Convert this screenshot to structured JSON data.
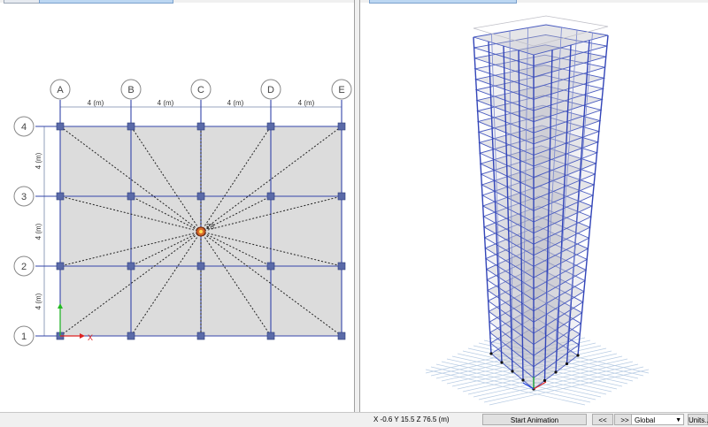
{
  "plan_view": {
    "grid_x_labels": [
      "A",
      "B",
      "C",
      "D",
      "E"
    ],
    "grid_y_labels": [
      "4",
      "3",
      "2",
      "1"
    ],
    "x_spacing_labels": [
      "4 (m)",
      "4 (m)",
      "4 (m)",
      "4 (m)"
    ],
    "y_spacing_labels": [
      "4 (m)",
      "4 (m)",
      "4 (m)"
    ],
    "axis_x_label": "X",
    "point_label": "23"
  },
  "status_bar": {
    "coordinates": "X -0.6  Y 15.5  Z 76.5 (m)",
    "start_animation_label": "Start Animation",
    "step_back_label": "<<",
    "step_forward_label": ">>",
    "coord_system": "Global",
    "units_label": "Units..."
  },
  "colors": {
    "grid": "#3344aa",
    "slab": "#dcdcdc",
    "column": "#5a6aa8"
  }
}
